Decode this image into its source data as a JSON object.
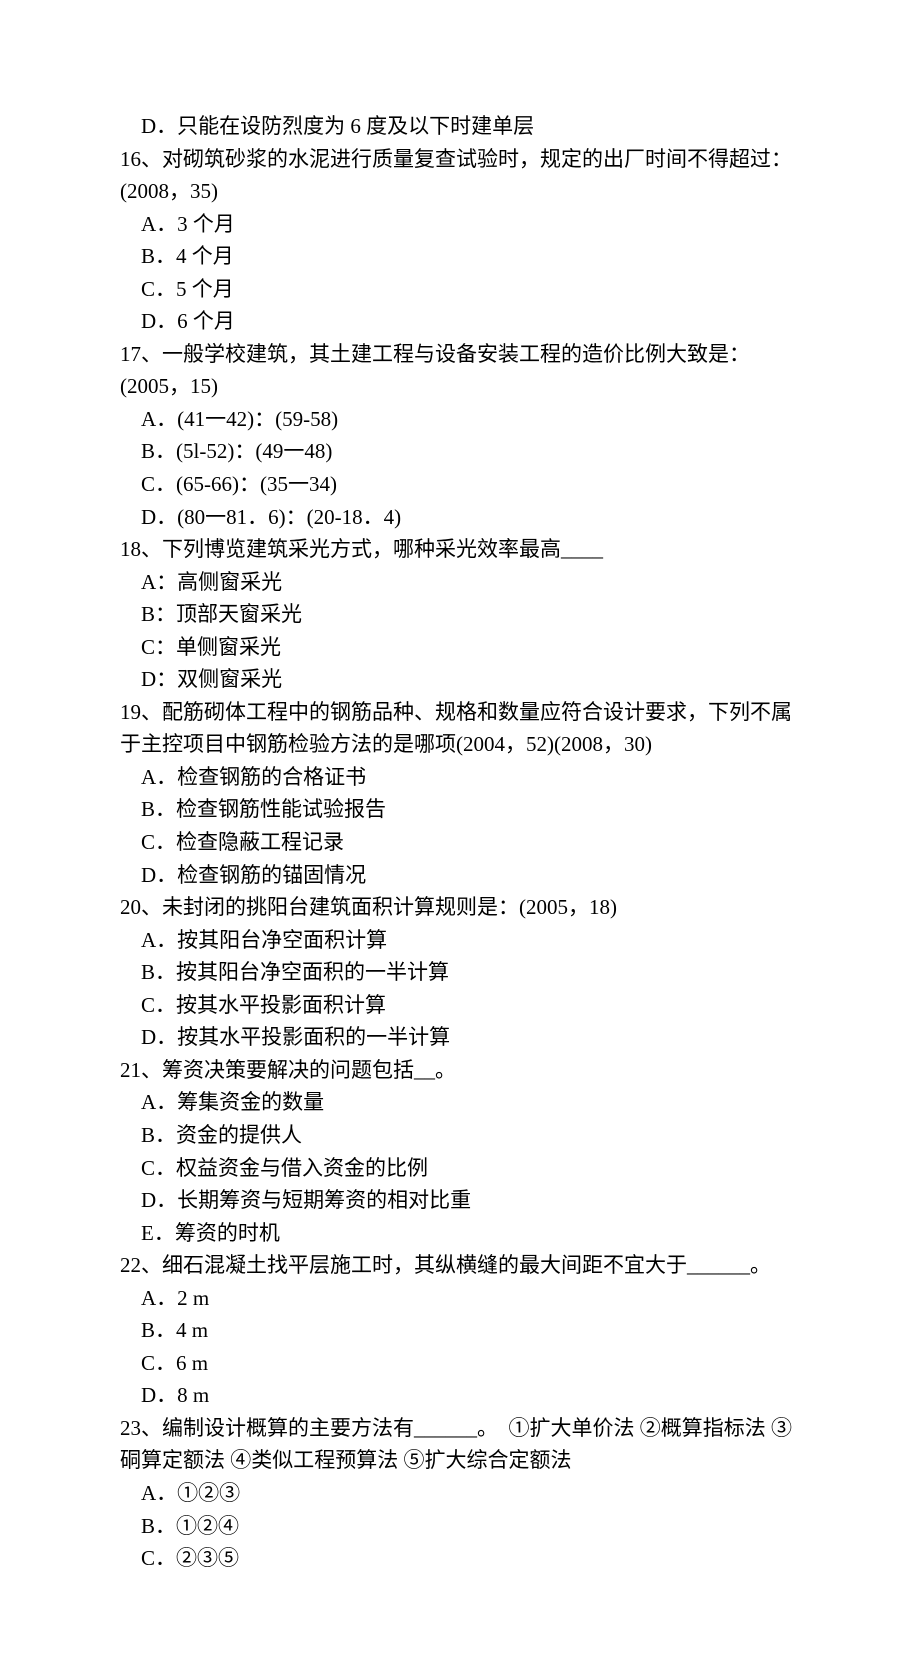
{
  "lines": [
    "　D．只能在设防烈度为 6 度及以下时建单层",
    "16、对砌筑砂浆的水泥进行质量复查试验时，规定的出厂时间不得超过：(2008，35)",
    "　A．3 个月",
    "　B．4 个月",
    "　C．5 个月",
    "　D．6 个月",
    "17、一般学校建筑，其土建工程与设备安装工程的造价比例大致是：(2005，15)",
    "　A．(41一42)：(59-58)",
    "　B．(5l-52)：(49一48)",
    "　C．(65-66)：(35一34)",
    "　D．(80一81．6)：(20-18．4)",
    "18、下列博览建筑采光方式，哪种采光效率最高____",
    "　A：高侧窗采光",
    "　B：顶部天窗采光",
    "　C：单侧窗采光",
    "　D：双侧窗采光",
    "19、配筋砌体工程中的钢筋品种、规格和数量应符合设计要求，下列不属于主控项目中钢筋检验方法的是哪项(2004，52)(2008，30)",
    "　A．检查钢筋的合格证书",
    "　B．检查钢筋性能试验报告",
    "　C．检查隐蔽工程记录",
    "　D．检查钢筋的锚固情况",
    "20、未封闭的挑阳台建筑面积计算规则是：(2005，18)",
    "　A．按其阳台净空面积计算",
    "　B．按其阳台净空面积的一半计算",
    "　C．按其水平投影面积计算",
    "　D．按其水平投影面积的一半计算",
    "21、筹资决策要解决的问题包括__。",
    "　A．筹集资金的数量",
    "　B．资金的提供人",
    "　C．权益资金与借入资金的比例",
    "　D．长期筹资与短期筹资的相对比重",
    "　E．筹资的时机",
    "22、细石混凝土找平层施工时，其纵横缝的最大间距不宜大于______。",
    "　A．2 m",
    "　B．4 m",
    "　C．6 m",
    "　D．8 m",
    "23、编制设计概算的主要方法有______。　①扩大单价法 ②概算指标法 ③硐算定额法 ④类似工程预算法 ⑤扩大综合定额法",
    "　A．①②③",
    "　B．①②④",
    "　C．②③⑤"
  ]
}
